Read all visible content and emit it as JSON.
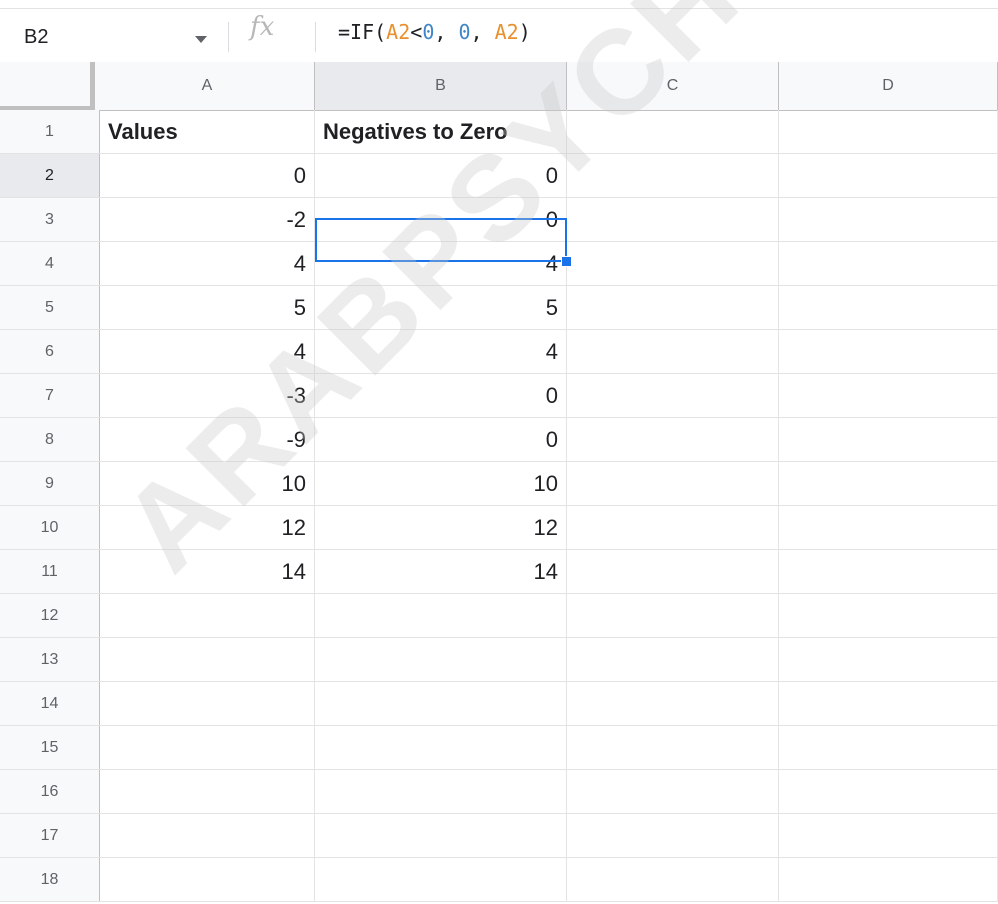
{
  "formula_bar": {
    "cell_ref": "B2",
    "fx_label": "fx",
    "formula_parts": [
      "=IF(",
      "A2",
      "<",
      "0",
      ", ",
      "0",
      ", ",
      "A2",
      ")"
    ]
  },
  "columns": [
    "A",
    "B",
    "C",
    "D"
  ],
  "rows": [
    {
      "num": "1",
      "a": "Values",
      "b": "Negatives to Zero"
    },
    {
      "num": "2",
      "a": "0",
      "b": "0"
    },
    {
      "num": "3",
      "a": "-2",
      "b": "0"
    },
    {
      "num": "4",
      "a": "4",
      "b": "4"
    },
    {
      "num": "5",
      "a": "5",
      "b": "5"
    },
    {
      "num": "6",
      "a": "4",
      "b": "4"
    },
    {
      "num": "7",
      "a": "-3",
      "b": "0"
    },
    {
      "num": "8",
      "a": "-9",
      "b": "0"
    },
    {
      "num": "9",
      "a": "10",
      "b": "10"
    },
    {
      "num": "10",
      "a": "12",
      "b": "12"
    },
    {
      "num": "11",
      "a": "14",
      "b": "14"
    },
    {
      "num": "12",
      "a": "",
      "b": ""
    },
    {
      "num": "13",
      "a": "",
      "b": ""
    },
    {
      "num": "14",
      "a": "",
      "b": ""
    },
    {
      "num": "15",
      "a": "",
      "b": ""
    },
    {
      "num": "16",
      "a": "",
      "b": ""
    },
    {
      "num": "17",
      "a": "",
      "b": ""
    },
    {
      "num": "18",
      "a": "",
      "b": ""
    }
  ],
  "selected_cell": "B2",
  "watermark": "ARABPSYCHOLOGY.C",
  "colors": {
    "selection": "#1a73e8",
    "ref_orange": "#e8902d",
    "number_blue": "#3e86c8"
  }
}
